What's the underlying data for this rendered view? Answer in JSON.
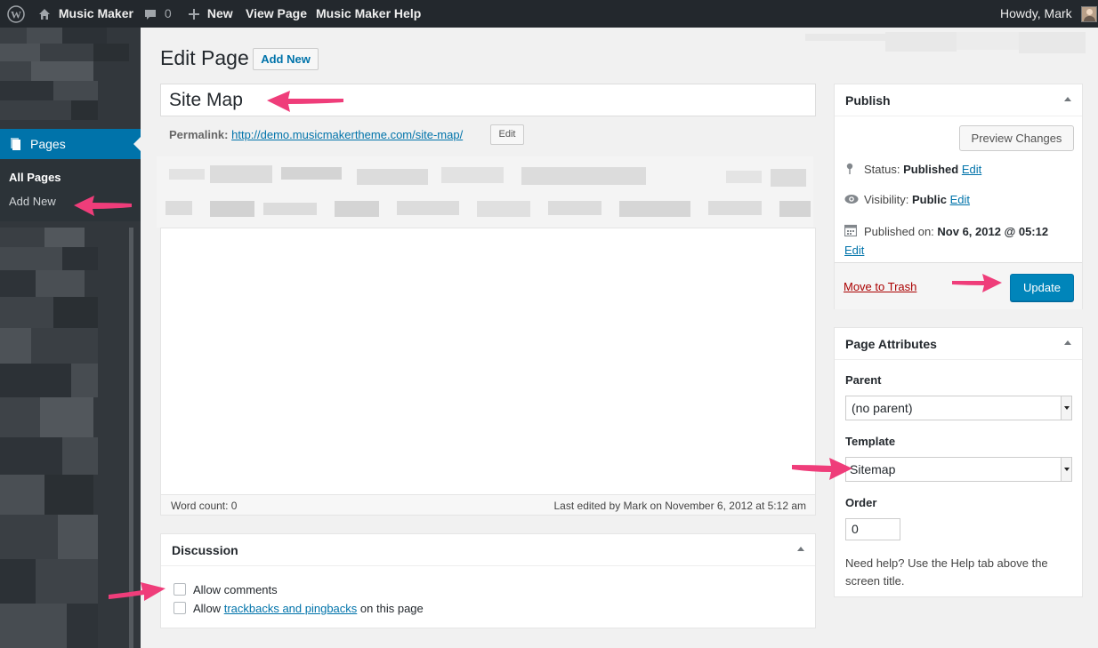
{
  "colors": {
    "accent": "#0073aa",
    "admin_bar": "#23282d",
    "sidebar": "#32373c",
    "annotation_arrow": "#ef3d7a",
    "update_button": "#0085ba"
  },
  "admin_bar": {
    "wp_logo_icon": "wordpress-logo-icon",
    "site_name": "Music Maker",
    "comments_count": "0",
    "new_label": "New",
    "view_page_label": "View Page",
    "help_label": "Music Maker Help",
    "greeting": "Howdy, Mark"
  },
  "sidebar": {
    "pages_label": "Pages",
    "submenu": {
      "all_pages": "All Pages",
      "add_new": "Add New"
    }
  },
  "page": {
    "heading": "Edit Page",
    "add_new_button": "Add New",
    "title_value": "Site Map",
    "permalink_label": "Permalink:",
    "permalink_url": "http://demo.musicmakertheme.com/site-map/",
    "permalink_edit": "Edit",
    "word_count": "Word count: 0",
    "last_edited": "Last edited by Mark on November 6, 2012 at 5:12 am"
  },
  "discussion": {
    "title": "Discussion",
    "allow_comments": "Allow comments",
    "allow_prefix": "Allow",
    "trackbacks_link": "trackbacks and pingbacks",
    "allow_suffix": "on this page",
    "allow_comments_checked": false,
    "allow_pings_checked": false
  },
  "publish": {
    "title": "Publish",
    "preview_button": "Preview Changes",
    "status_label": "Status:",
    "status_value": "Published",
    "visibility_label": "Visibility:",
    "visibility_value": "Public",
    "published_on_label": "Published on:",
    "published_on_value": "Nov 6, 2012 @ 05:12",
    "edit_label": "Edit",
    "move_to_trash": "Move to Trash",
    "update_button": "Update"
  },
  "attributes": {
    "title": "Page Attributes",
    "parent_label": "Parent",
    "parent_value": "(no parent)",
    "template_label": "Template",
    "template_value": "Sitemap",
    "order_label": "Order",
    "order_value": "0",
    "help_text": "Need help? Use the Help tab above the screen title."
  }
}
